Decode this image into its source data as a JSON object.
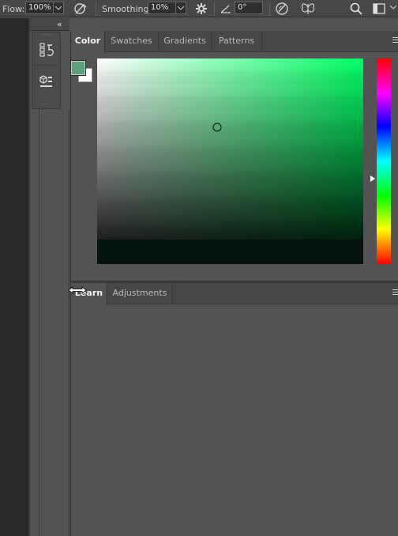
{
  "options_bar": {
    "flow_label": "Flow:",
    "flow_value": "100%",
    "smoothing_label": "Smoothing:",
    "smoothing_value": "10%",
    "angle_value": "0°"
  },
  "color_panel": {
    "tabs": [
      {
        "label": "Color",
        "active": true
      },
      {
        "label": "Swatches",
        "active": false
      },
      {
        "label": "Gradients",
        "active": false
      },
      {
        "label": "Patterns",
        "active": false
      }
    ],
    "foreground_color": "#5aa27d",
    "background_color": "#ffffff",
    "hue_base_color": "#00ff64"
  },
  "lower_panel": {
    "tabs": [
      {
        "label": "Learn",
        "active": true
      },
      {
        "label": "Adjustments",
        "active": false
      }
    ]
  },
  "dock": {
    "collapse_glyph": "«",
    "items": [
      {
        "icon": "history-icon"
      },
      {
        "icon": "properties-icon"
      }
    ]
  }
}
